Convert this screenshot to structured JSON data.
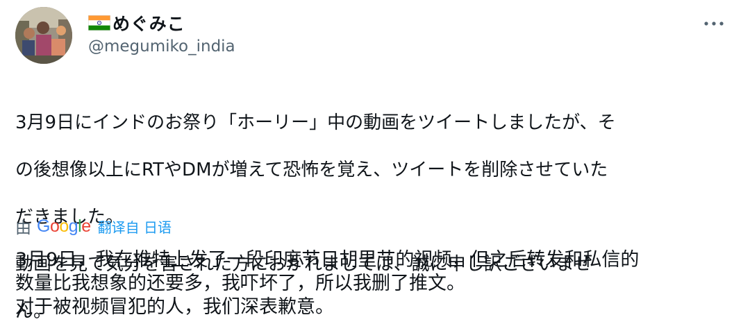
{
  "author": {
    "display_name": "めぐみこ",
    "handle": "@megumiko_india",
    "flag_icon": "india-flag-icon"
  },
  "tweet": {
    "original_lines": [
      "3月9日にインドのお祭り「ホーリー」中の動画をツイートしましたが、そ",
      "の後想像以上にRTやDMが増えて恐怖を覚え、ツイートを削除させていた",
      "だきました。",
      "動画を見て気分を害された方におかれましては、誠に申し訳ございませ",
      "ん。"
    ],
    "translation_by": "由",
    "translation_service": "Google",
    "translated_from": "翻译自 日语",
    "translated_lines": [
      "3月9日，我在推特上发了一段印度节日胡里节的视频，但之后转发和私信的",
      "数量比我想象的还要多，我吓坏了，所以我删了推文。",
      "对于被视频冒犯的人，我们深表歉意。"
    ]
  },
  "colors": {
    "text_primary": "#0f1419",
    "text_secondary": "#536471",
    "link": "#1d9bf0",
    "google_blue": "#4285F4",
    "google_red": "#EA4335",
    "google_yellow": "#FBBC05",
    "google_green": "#34A853"
  },
  "icons": {
    "more": "more-horizontal-icon",
    "avatar": "profile-avatar"
  }
}
